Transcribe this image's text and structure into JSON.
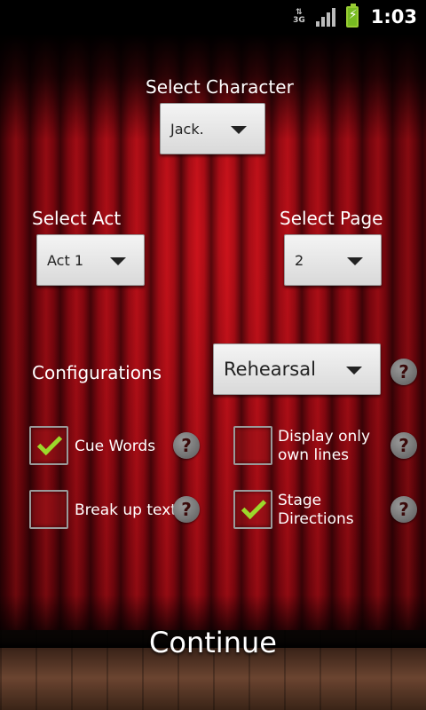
{
  "status_bar": {
    "network": "3G",
    "time": "1:03"
  },
  "character": {
    "label": "Select Character",
    "value": "Jack."
  },
  "act": {
    "label": "Select Act",
    "value": "Act 1"
  },
  "page": {
    "label": "Select Page",
    "value": "2"
  },
  "configurations": {
    "label": "Configurations",
    "mode": "Rehearsal",
    "help": "?"
  },
  "options": [
    {
      "label": "Cue Words",
      "checked": true,
      "help": "?"
    },
    {
      "label": "Display only own lines",
      "checked": false,
      "help": "?"
    },
    {
      "label": "Break up text",
      "checked": false,
      "help": "?"
    },
    {
      "label": "Stage Directions",
      "checked": true,
      "help": "?"
    }
  ],
  "continue_label": "Continue",
  "colors": {
    "curtain": "#b0101a",
    "check": "#9cd92b",
    "spinner_bg": "#e6e6e6"
  }
}
